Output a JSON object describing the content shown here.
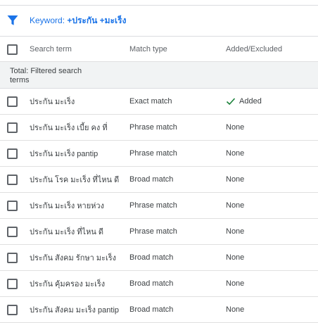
{
  "filter": {
    "icon": "filter-icon",
    "keyword_label": "Keyword: ",
    "keyword_value": "+ประกัน +มะเร็ง",
    "color": "#1a73e8"
  },
  "table": {
    "headers": {
      "term": "Search term",
      "match": "Match type",
      "status": "Added/Excluded"
    },
    "total_label": "Total: Filtered search terms",
    "rows": [
      {
        "term": "ประกัน มะเร็ง",
        "match": "Exact match",
        "status": "Added",
        "status_icon": "check-icon"
      },
      {
        "term": "ประกัน มะเร็ง เบี้ย คง ที่",
        "match": "Phrase match",
        "status": "None"
      },
      {
        "term": "ประกัน มะเร็ง pantip",
        "match": "Phrase match",
        "status": "None"
      },
      {
        "term": "ประกัน โรค มะเร็ง ที่ไหน ดี",
        "match": "Broad match",
        "status": "None"
      },
      {
        "term": "ประกัน มะเร็ง หายห่วง",
        "match": "Phrase match",
        "status": "None"
      },
      {
        "term": "ประกัน มะเร็ง ที่ไหน ดี",
        "match": "Phrase match",
        "status": "None"
      },
      {
        "term": "ประกัน สังคม รักษา มะเร็ง",
        "match": "Broad match",
        "status": "None"
      },
      {
        "term": "ประกัน คุ้มครอง มะเร็ง",
        "match": "Broad match",
        "status": "None"
      },
      {
        "term": "ประกัน สังคม มะเร็ง pantip",
        "match": "Broad match",
        "status": "None"
      }
    ]
  },
  "colors": {
    "accent": "#1a73e8",
    "added_check": "#188038",
    "total_bg": "#f1f3f4",
    "divider": "#e0e0e0"
  }
}
